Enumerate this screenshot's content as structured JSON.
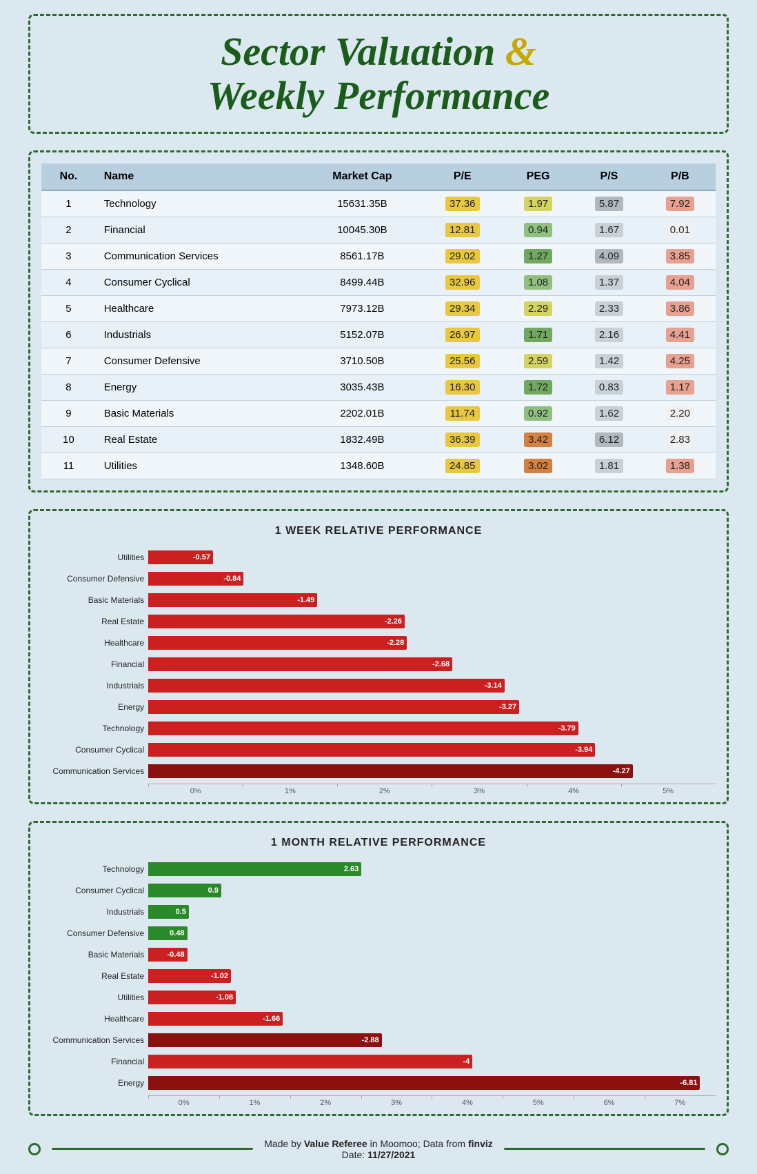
{
  "title": {
    "line1": "Sector Valuation ",
    "amp": "&",
    "line2": "Weekly Performance"
  },
  "table": {
    "headers": [
      "No.",
      "Name",
      "Market Cap",
      "P/E",
      "PEG",
      "P/S",
      "P/B"
    ],
    "rows": [
      {
        "no": 1,
        "name": "Technology",
        "market_cap": "15631.35B",
        "pe": "37.36",
        "peg": "1.97",
        "ps": "5.87",
        "pb": "7.92",
        "pe_class": "pe-yellow",
        "peg_class": "peg-yellow",
        "ps_class": "ps-gray",
        "pb_class": "pb-salmon"
      },
      {
        "no": 2,
        "name": "Financial",
        "market_cap": "10045.30B",
        "pe": "12.81",
        "peg": "0.94",
        "ps": "1.67",
        "pb": "0.01",
        "pe_class": "pe-yellow",
        "peg_class": "peg-green-light",
        "ps_class": "ps-lgray",
        "pb_class": "pb-white"
      },
      {
        "no": 3,
        "name": "Communication Services",
        "market_cap": "8561.17B",
        "pe": "29.02",
        "peg": "1.27",
        "ps": "4.09",
        "pb": "3.85",
        "pe_class": "pe-yellow",
        "peg_class": "peg-green-mid",
        "ps_class": "ps-gray",
        "pb_class": "pb-salmon"
      },
      {
        "no": 4,
        "name": "Consumer Cyclical",
        "market_cap": "8499.44B",
        "pe": "32.96",
        "peg": "1.08",
        "ps": "1.37",
        "pb": "4.04",
        "pe_class": "pe-yellow",
        "peg_class": "peg-green-light",
        "ps_class": "ps-lgray",
        "pb_class": "pb-salmon"
      },
      {
        "no": 5,
        "name": "Healthcare",
        "market_cap": "7973.12B",
        "pe": "29.34",
        "peg": "2.29",
        "ps": "2.33",
        "pb": "3.86",
        "pe_class": "pe-yellow",
        "peg_class": "peg-yellow",
        "ps_class": "ps-lgray",
        "pb_class": "pb-salmon"
      },
      {
        "no": 6,
        "name": "Industrials",
        "market_cap": "5152.07B",
        "pe": "26.97",
        "peg": "1.71",
        "ps": "2.16",
        "pb": "4.41",
        "pe_class": "pe-yellow",
        "peg_class": "peg-green-mid",
        "ps_class": "ps-lgray",
        "pb_class": "pb-salmon"
      },
      {
        "no": 7,
        "name": "Consumer Defensive",
        "market_cap": "3710.50B",
        "pe": "25.56",
        "peg": "2.59",
        "ps": "1.42",
        "pb": "4.25",
        "pe_class": "pe-yellow",
        "peg_class": "peg-yellow",
        "ps_class": "ps-lgray",
        "pb_class": "pb-salmon"
      },
      {
        "no": 8,
        "name": "Energy",
        "market_cap": "3035.43B",
        "pe": "16.30",
        "peg": "1.72",
        "ps": "0.83",
        "pb": "1.17",
        "pe_class": "pe-yellow",
        "peg_class": "peg-green-mid",
        "ps_class": "ps-lgray",
        "pb_class": "pb-salmon"
      },
      {
        "no": 9,
        "name": "Basic Materials",
        "market_cap": "2202.01B",
        "pe": "11.74",
        "peg": "0.92",
        "ps": "1.62",
        "pb": "2.20",
        "pe_class": "pe-yellow",
        "peg_class": "peg-green-light",
        "ps_class": "ps-lgray",
        "pb_class": "pb-white"
      },
      {
        "no": 10,
        "name": "Real Estate",
        "market_cap": "1832.49B",
        "pe": "36.39",
        "peg": "3.42",
        "ps": "6.12",
        "pb": "2.83",
        "pe_class": "pe-yellow",
        "peg_class": "peg-orange",
        "ps_class": "ps-gray",
        "pb_class": "pb-white"
      },
      {
        "no": 11,
        "name": "Utilities",
        "market_cap": "1348.60B",
        "pe": "24.85",
        "peg": "3.02",
        "ps": "1.81",
        "pb": "1.38",
        "pe_class": "pe-yellow",
        "peg_class": "peg-orange",
        "ps_class": "ps-lgray",
        "pb_class": "pb-salmon"
      }
    ]
  },
  "chart1": {
    "title": "1 WEEK RELATIVE PERFORMANCE",
    "max_pct": 5,
    "bars": [
      {
        "label": "Utilities",
        "value": -0.57,
        "type": "red"
      },
      {
        "label": "Consumer Defensive",
        "value": -0.84,
        "type": "red"
      },
      {
        "label": "Basic Materials",
        "value": -1.49,
        "type": "red"
      },
      {
        "label": "Real Estate",
        "value": -2.26,
        "type": "red"
      },
      {
        "label": "Healthcare",
        "value": -2.28,
        "type": "red"
      },
      {
        "label": "Financial",
        "value": -2.68,
        "type": "red"
      },
      {
        "label": "Industrials",
        "value": -3.14,
        "type": "red"
      },
      {
        "label": "Energy",
        "value": -3.27,
        "type": "red"
      },
      {
        "label": "Technology",
        "value": -3.79,
        "type": "red"
      },
      {
        "label": "Consumer Cyclical",
        "value": -3.94,
        "type": "red"
      },
      {
        "label": "Communication Services",
        "value": -4.27,
        "type": "dark-red"
      }
    ],
    "x_ticks": [
      "0%",
      "1%",
      "2%",
      "3%",
      "4%",
      "5%"
    ]
  },
  "chart2": {
    "title": "1 MONTH RELATIVE PERFORMANCE",
    "max_pct": 7,
    "bars": [
      {
        "label": "Technology",
        "value": 2.63,
        "type": "green"
      },
      {
        "label": "Consumer Cyclical",
        "value": 0.9,
        "type": "green"
      },
      {
        "label": "Industrials",
        "value": 0.5,
        "type": "green"
      },
      {
        "label": "Consumer Defensive",
        "value": 0.48,
        "type": "green"
      },
      {
        "label": "Basic Materials",
        "value": -0.48,
        "type": "red"
      },
      {
        "label": "Real Estate",
        "value": -1.02,
        "type": "red"
      },
      {
        "label": "Utilities",
        "value": -1.08,
        "type": "red"
      },
      {
        "label": "Healthcare",
        "value": -1.66,
        "type": "red"
      },
      {
        "label": "Communication Services",
        "value": -2.88,
        "type": "dark-red"
      },
      {
        "label": "Financial",
        "value": -4,
        "type": "red"
      },
      {
        "label": "Energy",
        "value": -6.81,
        "type": "dark-red"
      }
    ],
    "x_ticks": [
      "0%",
      "1%",
      "2%",
      "3%",
      "4%",
      "5%",
      "6%",
      "7%"
    ]
  },
  "footer": {
    "text1": "Made by ",
    "brand": "Value Referee",
    "text2": " in Moomoo; Data from ",
    "source": "finviz",
    "date_label": "Date: ",
    "date": "11/27/2021"
  }
}
